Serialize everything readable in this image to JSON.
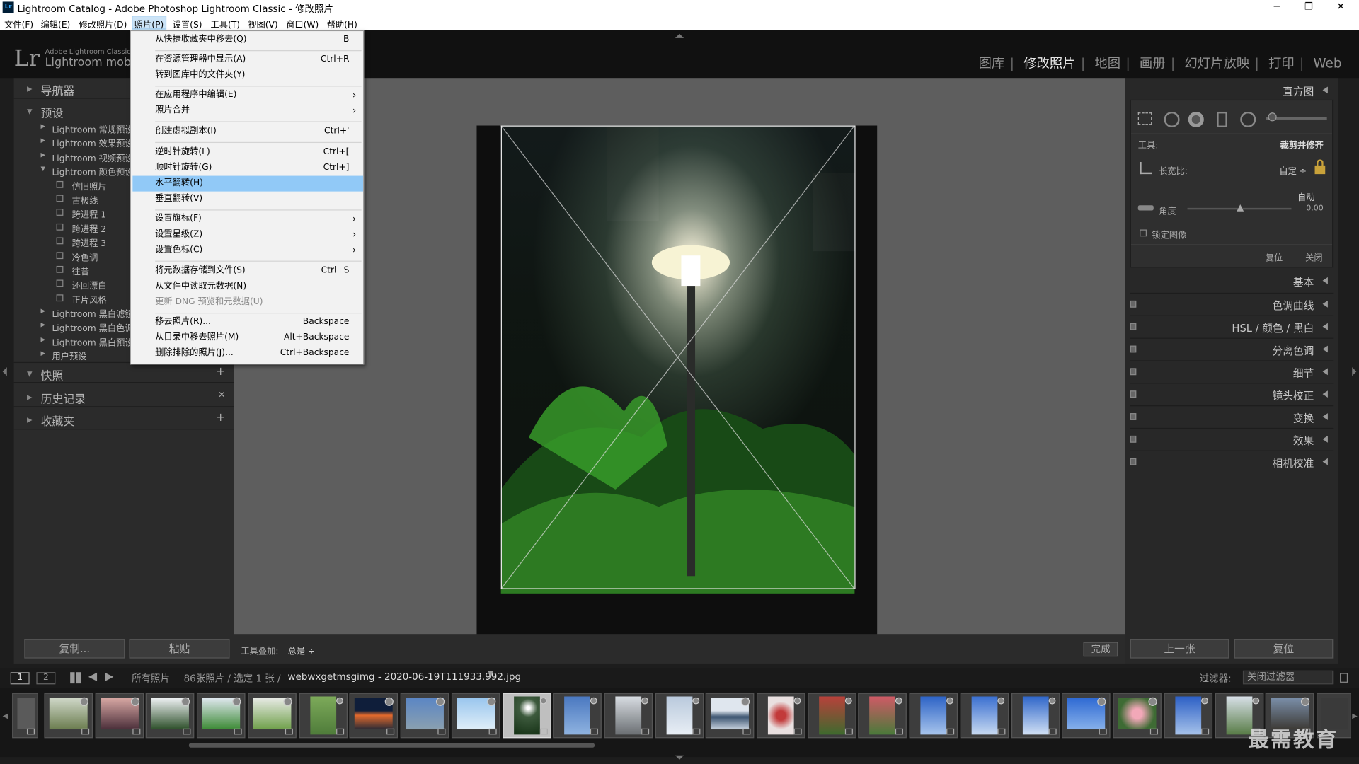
{
  "window": {
    "title": "Lightroom Catalog - Adobe Photoshop Lightroom Classic - 修改照片",
    "minimize": "─",
    "maximize": "❐",
    "close": "✕"
  },
  "menubar": [
    "文件(F)",
    "编辑(E)",
    "修改照片(D)",
    "照片(P)",
    "设置(S)",
    "工具(T)",
    "视图(V)",
    "窗口(W)",
    "帮助(H)"
  ],
  "brand": {
    "logo": "Lr",
    "line1": "Adobe Lightroom Classic",
    "line2": "Lightroom mobi"
  },
  "modules": [
    "图库",
    "修改照片",
    "地图",
    "画册",
    "幻灯片放映",
    "打印",
    "Web"
  ],
  "left_panel": {
    "navigator": "导航器",
    "presets": "预设",
    "preset_groups": [
      "Lightroom 常规预设",
      "Lightroom 效果预设",
      "Lightroom 视频预设",
      "Lightroom 颜色预设"
    ],
    "preset_children": [
      "仿旧照片",
      "古极线",
      "跨进程 1",
      "跨进程 2",
      "跨进程 3",
      "冷色调",
      "往昔",
      "还回漂白",
      "正片风格"
    ],
    "preset_groups_after": [
      "Lightroom 黑白滤镜",
      "Lightroom 黑白色调",
      "Lightroom 黑白预设",
      "用户预设"
    ],
    "snapshots": "快照",
    "history": "历史记录",
    "collections": "收藏夹",
    "plus": "+",
    "x": "✕",
    "copy": "复制...",
    "paste": "粘贴"
  },
  "photo_menu": {
    "items": [
      {
        "label": "从快捷收藏夹中移去(Q)",
        "shortcut": "B"
      },
      {
        "label": "在资源管理器中显示(A)",
        "shortcut": "Ctrl+R"
      },
      {
        "label": "转到图库中的文件夹(Y)",
        "shortcut": ""
      },
      {
        "label": "在应用程序中编辑(E)",
        "shortcut": "›"
      },
      {
        "label": "照片合并",
        "shortcut": "›"
      },
      {
        "label": "创建虚拟副本(I)",
        "shortcut": "Ctrl+'"
      },
      {
        "label": "逆时针旋转(L)",
        "shortcut": "Ctrl+["
      },
      {
        "label": "顺时针旋转(G)",
        "shortcut": "Ctrl+]"
      },
      {
        "label": "水平翻转(H)",
        "shortcut": ""
      },
      {
        "label": "垂直翻转(V)",
        "shortcut": ""
      },
      {
        "label": "设置旗标(F)",
        "shortcut": "›"
      },
      {
        "label": "设置星级(Z)",
        "shortcut": "›"
      },
      {
        "label": "设置色标(C)",
        "shortcut": "›"
      },
      {
        "label": "将元数据存储到文件(S)",
        "shortcut": "Ctrl+S"
      },
      {
        "label": "从文件中读取元数据(N)",
        "shortcut": ""
      },
      {
        "label": "更新 DNG 预览和元数据(U)",
        "shortcut": ""
      },
      {
        "label": "移去照片(R)...",
        "shortcut": "Backspace"
      },
      {
        "label": "从目录中移去照片(M)",
        "shortcut": "Alt+Backspace"
      },
      {
        "label": "删除排除的照片(J)...",
        "shortcut": "Ctrl+Backspace"
      }
    ],
    "highlighted": "水平翻转(H)"
  },
  "toolbar": {
    "overlay_label": "工具叠加:",
    "overlay_value": "总是 ÷",
    "done": "完成"
  },
  "right_panel": {
    "histogram": "直方图",
    "tool_label": "工具:",
    "tool_value": "裁剪并修齐",
    "aspect_label": "长宽比:",
    "aspect_value": "自定 ÷",
    "auto": "自动",
    "angle_label": "角度",
    "angle_value": "0.00",
    "lock_image": "锁定图像",
    "reset": "复位",
    "close": "关闭",
    "sections": [
      "基本",
      "色调曲线",
      "HSL / 颜色 / 黑白",
      "分离色调",
      "细节",
      "镜头校正",
      "变换",
      "效果",
      "相机校准"
    ],
    "prev": "上一张",
    "reset_btn": "复位"
  },
  "filmstrip": {
    "page1": "1",
    "page2": "2",
    "source": "所有照片",
    "count": "86张照片 / 选定 1 张 /",
    "filename": "webwxgetmsgimg - 2020-06-19T111933.992.jpg",
    "filter_label": "过滤器:",
    "filter_value": "关闭过滤器"
  },
  "watermark": "最需教育",
  "colors": {
    "accent": "#91c9f7",
    "panel": "#2b2b2b",
    "bg": "#1d1d1d"
  }
}
